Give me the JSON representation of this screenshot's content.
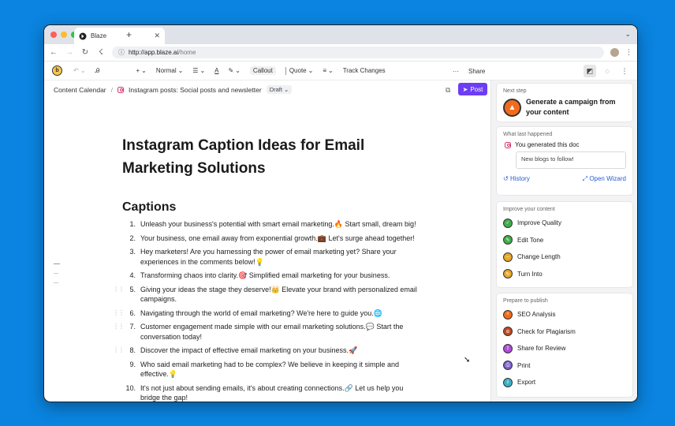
{
  "browser": {
    "tab_title": "Blaze",
    "url_host": "http://app.blaze.ai",
    "url_path": "/home"
  },
  "toolbar": {
    "plus": "+",
    "style": "Normal",
    "callout": "Callout",
    "quote": "Quote",
    "track_changes": "Track Changes",
    "more": "···",
    "share": "Share"
  },
  "breadcrumb": {
    "root": "Content Calendar",
    "separator": "/",
    "current": "Instagram posts: Social posts and newsletter",
    "status": "Draft"
  },
  "post_button": "Post",
  "document": {
    "title": "Instagram Caption Ideas for Email Marketing Solutions",
    "section_heading": "Captions",
    "captions": [
      {
        "num": "1.",
        "text": "Unleash your business's potential with smart email marketing.🔥 Start small, dream big!"
      },
      {
        "num": "2.",
        "text": "Your business, one email away from exponential growth.💼 Let's surge ahead together!"
      },
      {
        "num": "3.",
        "text": "Hey marketers! Are you harnessing the power of email marketing yet? Share your experiences in the comments below!💡"
      },
      {
        "num": "4.",
        "text": "Transforming chaos into clarity.🎯 Simplified email marketing for your business."
      },
      {
        "num": "5.",
        "text": "Giving your ideas the stage they deserve!👑 Elevate your brand with personalized email campaigns."
      },
      {
        "num": "6.",
        "text": "Navigating through the world of email marketing? We're here to guide you.🌐"
      },
      {
        "num": "7.",
        "text": "Customer engagement made simple with our email marketing solutions.💬 Start the conversation today!"
      },
      {
        "num": "8.",
        "text": "Discover the impact of effective email marketing on your business.🚀"
      },
      {
        "num": "9.",
        "text": "Who said email marketing had to be complex? We believe in keeping it simple and effective.💡"
      },
      {
        "num": "10.",
        "text": "It's not just about sending emails, it's about creating connections.🔗 Let us help you bridge the gap!"
      }
    ]
  },
  "sidebar": {
    "next_step": {
      "heading": "Next step",
      "action": "Generate a campaign from your content"
    },
    "last_happened": {
      "heading": "What last happened",
      "event": "You generated this doc",
      "input_value": "New blogs to follow!",
      "history": "History",
      "open_wizard": "Open Wizard"
    },
    "improve": {
      "heading": "Improve your content",
      "items": [
        {
          "label": "Improve Quality",
          "color": "#3fae4a"
        },
        {
          "label": "Edit Tone",
          "color": "#3fae4a"
        },
        {
          "label": "Change Length",
          "color": "#e9a826"
        },
        {
          "label": "Turn Into",
          "color": "#e9a826"
        }
      ]
    },
    "publish": {
      "heading": "Prepare to publish",
      "items": [
        {
          "label": "SEO Analysis",
          "color": "#f26b1d"
        },
        {
          "label": "Check for Plagiarism",
          "color": "#c1491f"
        },
        {
          "label": "Share for Review",
          "color": "#b04fd6"
        },
        {
          "label": "Print",
          "color": "#7b5fd1"
        },
        {
          "label": "Export",
          "color": "#3ab1c8"
        }
      ]
    }
  },
  "colors": {
    "accent": "#6d3df5",
    "background": "#0a84e0",
    "link": "#2a5bd7"
  }
}
